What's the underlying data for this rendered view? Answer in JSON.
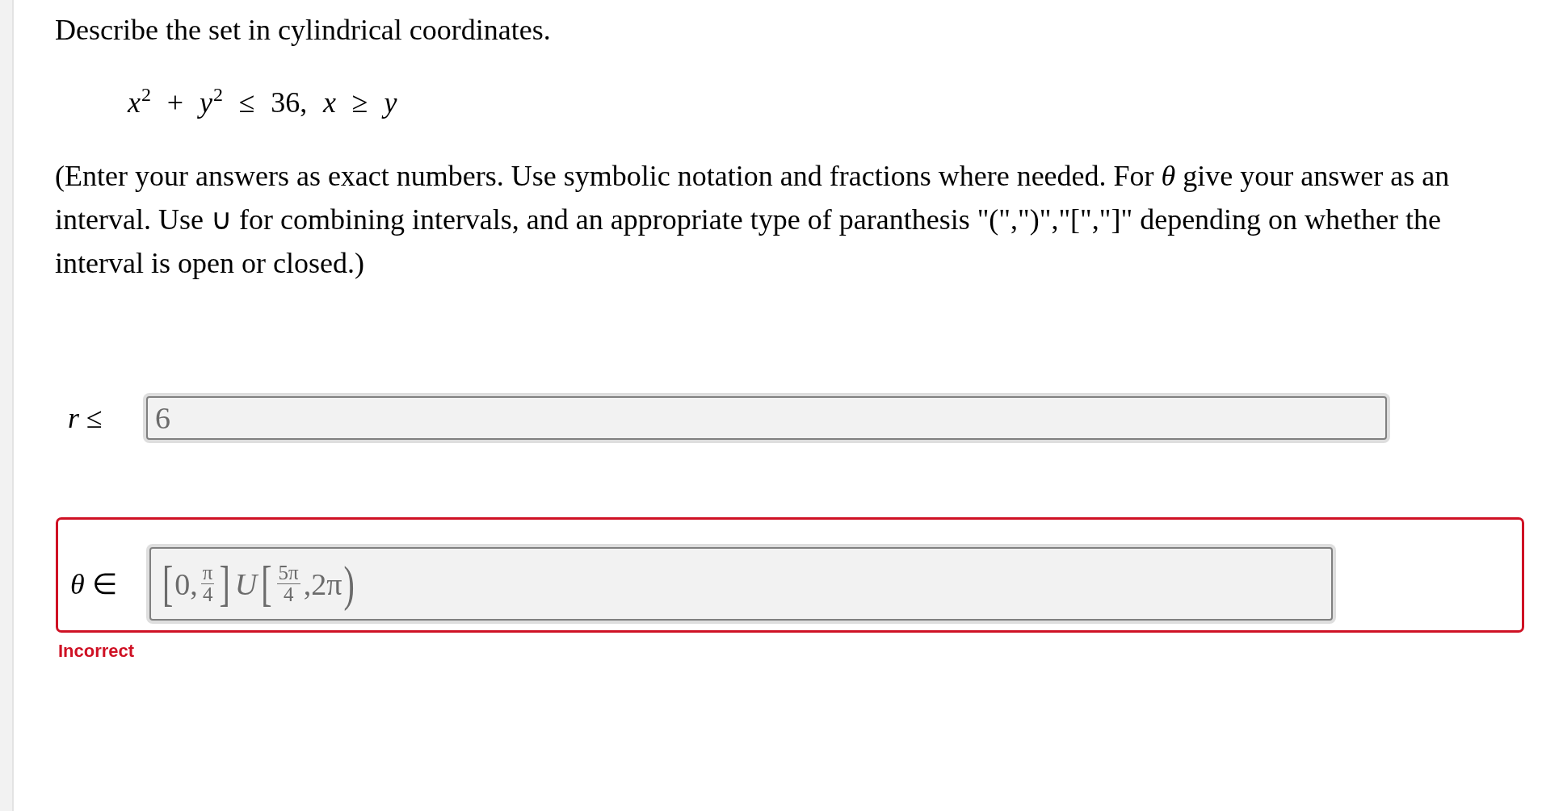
{
  "question": {
    "title": "Describe the set in cylindrical coordinates.",
    "formula": "*x*$^{2}$ + *y*$^{2}$ ≤ 36, *x* ≥ *y*",
    "instructions": "(Enter your answers as exact numbers. Use symbolic notation and fractions where needed. For *θ* give your answer as an interval. Use ∪ for combining intervals, and an appropriate type of paranthesis \"(\",\")\",\"[\",\"]\" depending on whether the interval is open or closed.)"
  },
  "answers": [
    {
      "label": "*r* ≤",
      "incorrect": false,
      "value": [
        {
          "kind": "text",
          "text": "6"
        }
      ]
    },
    {
      "label": "*θ* ∈",
      "incorrect": true,
      "feedback": "Incorrect",
      "value": [
        {
          "kind": "bracket",
          "text": "["
        },
        {
          "kind": "text",
          "text": "0,"
        },
        {
          "kind": "fraction",
          "numerator": "π",
          "denominator": "4"
        },
        {
          "kind": "bracket",
          "text": "]"
        },
        {
          "kind": "variable",
          "text": "U"
        },
        {
          "kind": "bracket",
          "text": "["
        },
        {
          "kind": "fraction",
          "numerator": "5π",
          "denominator": "4"
        },
        {
          "kind": "text",
          "text": ",2π"
        },
        {
          "kind": "bracket",
          "text": ")"
        }
      ]
    }
  ]
}
